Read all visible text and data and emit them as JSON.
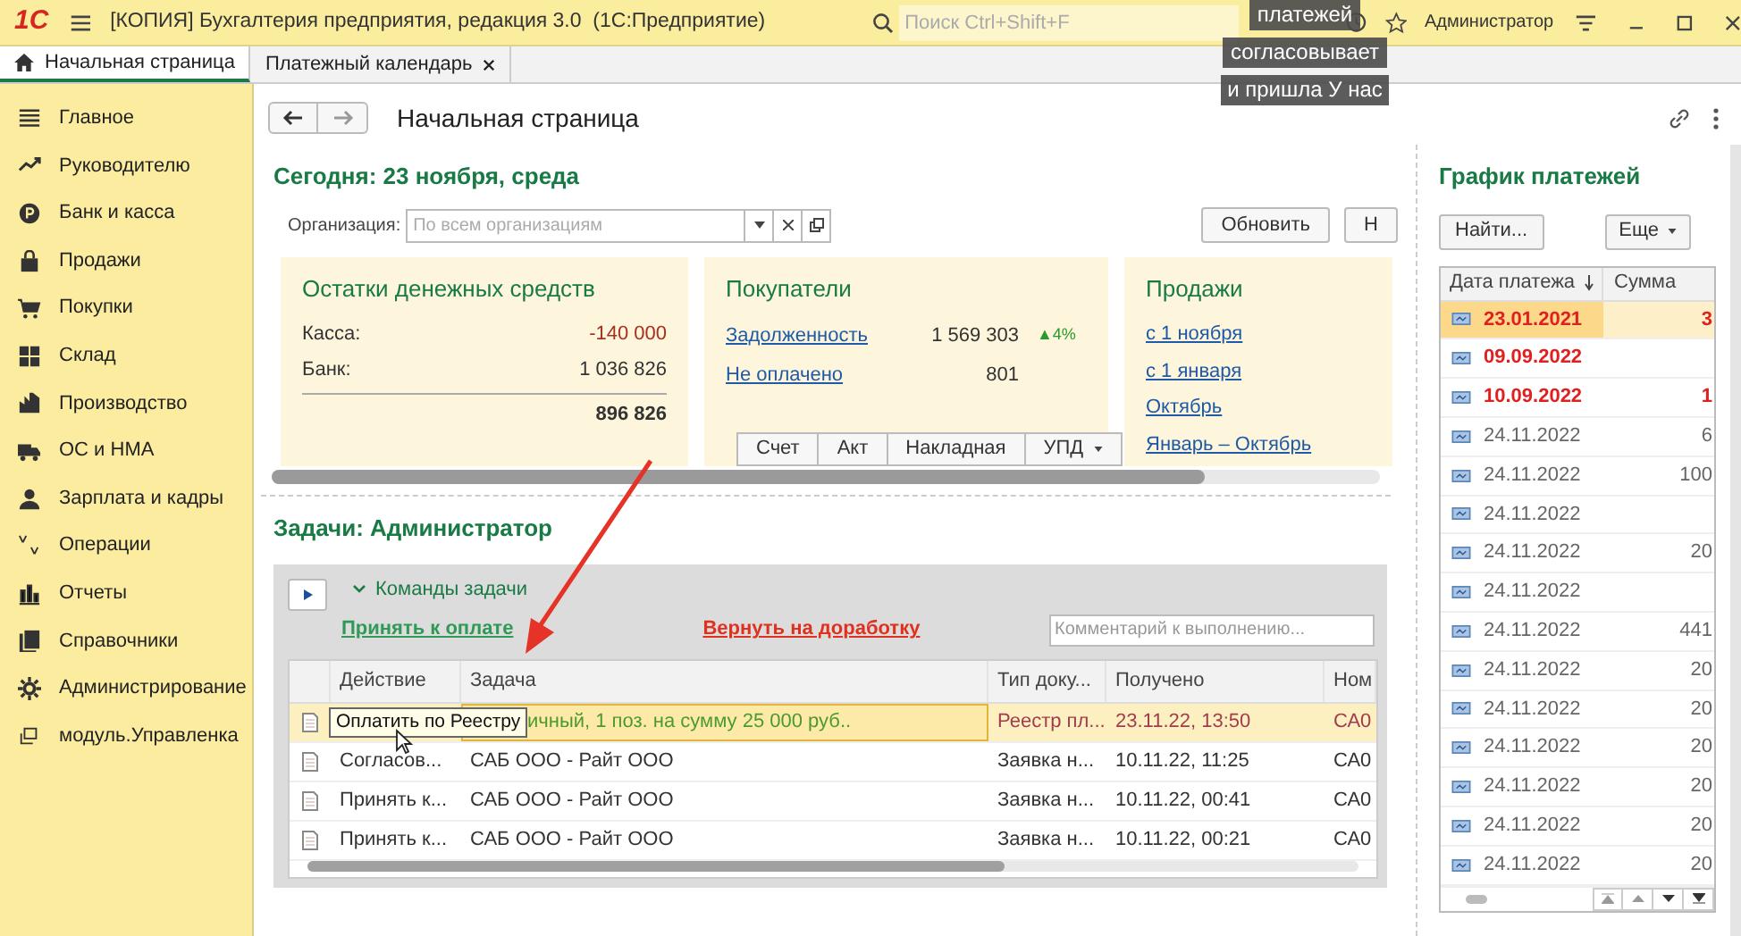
{
  "app_bar": {
    "logo": "1С",
    "title": "[КОПИЯ] Бухгалтерия предприятия, редакция 3.0  (1С:Предприятие)",
    "search": {
      "placeholder": "Поиск Ctrl+Shift+F"
    },
    "user": "Администратор"
  },
  "tabs": [
    {
      "label": "Начальная страница",
      "selected": true,
      "closable": false
    },
    {
      "label": "Платежный календарь",
      "selected": false,
      "closable": true
    }
  ],
  "sidebar": {
    "items": [
      {
        "label": "Главное"
      },
      {
        "label": "Руководителю"
      },
      {
        "label": "Банк и касса"
      },
      {
        "label": "Продажи"
      },
      {
        "label": "Покупки"
      },
      {
        "label": "Склад"
      },
      {
        "label": "Производство"
      },
      {
        "label": "ОС и НМА"
      },
      {
        "label": "Зарплата и кадры"
      },
      {
        "label": "Операции"
      },
      {
        "label": "Отчеты"
      },
      {
        "label": "Справочники"
      },
      {
        "label": "Администрирование"
      },
      {
        "label": "модуль.Управленка"
      }
    ]
  },
  "page": {
    "title": "Начальная страница"
  },
  "today": {
    "heading": "Сегодня: 23 ноября, среда",
    "org_label": "Организация:",
    "org_placeholder": "По всем организациям",
    "buttons": [
      "Обновить",
      "Н"
    ]
  },
  "cards": [
    {
      "kind": "balances",
      "title": "Остатки денежных средств",
      "rows": [
        {
          "label": "Касса:",
          "value": "-140 000",
          "negative": true
        },
        {
          "label": "Банк:",
          "value": "1 036 826",
          "negative": false
        }
      ],
      "total": "896 826"
    },
    {
      "kind": "customers",
      "title": "Покупатели",
      "rows": [
        {
          "label": "Задолженность",
          "value": "1 569 303",
          "trend": "▲4%"
        },
        {
          "label": "Не оплачено",
          "value": "801"
        }
      ],
      "buttons": [
        {
          "label": "Счет",
          "dropdown": false
        },
        {
          "label": "Акт",
          "dropdown": false
        },
        {
          "label": "Накладная",
          "dropdown": false
        },
        {
          "label": "УПД",
          "dropdown": true
        }
      ]
    },
    {
      "kind": "sales",
      "title": "Продажи",
      "links": [
        "с 1 ноября",
        "с 1 января",
        "Октябрь",
        "Январь – Октябрь"
      ]
    }
  ],
  "tasks": {
    "heading": "Задачи: Администратор",
    "commands_label": "Команды задачи",
    "accept": "Принять к оплате",
    "return": "Вернуть на доработку",
    "comment_placeholder": "Комментарий к выполнению...",
    "columns": [
      "Действие",
      "Задача",
      "Тип доку...",
      "Получено",
      "Ном"
    ],
    "rows": [
      {
        "action": "",
        "task": "ичный, 1 поз. на сумму 25 000 руб..",
        "type": "Реестр пл...",
        "received": "23.11.22, 13:50",
        "number": "СА0",
        "selected": true
      },
      {
        "action": "Согласов...",
        "task": "САБ ООО - Райт ООО",
        "type": "Заявка н...",
        "received": "10.11.22, 11:25",
        "number": "СА0",
        "selected": false
      },
      {
        "action": "Принять к...",
        "task": "САБ ООО - Райт ООО",
        "type": "Заявка н...",
        "received": "10.11.22, 00:41",
        "number": "СА0",
        "selected": false
      },
      {
        "action": "Принять к...",
        "task": "САБ ООО - Райт ООО",
        "type": "Заявка н...",
        "received": "10.11.22, 00:21",
        "number": "СА0",
        "selected": false
      }
    ],
    "tooltip": "Оплатить по Реестру"
  },
  "payments": {
    "heading": "График платежей",
    "find": "Найти...",
    "more": "Еще",
    "columns": [
      "Дата платежа",
      "Сумма"
    ],
    "rows": [
      {
        "date": "23.01.2021",
        "sum": "3",
        "overdue": true,
        "selected": true
      },
      {
        "date": "09.09.2022",
        "sum": "",
        "overdue": true,
        "selected": false
      },
      {
        "date": "10.09.2022",
        "sum": "1",
        "overdue": true,
        "selected": false
      },
      {
        "date": "24.11.2022",
        "sum": "6",
        "overdue": false,
        "selected": false
      },
      {
        "date": "24.11.2022",
        "sum": "100",
        "overdue": false,
        "selected": false
      },
      {
        "date": "24.11.2022",
        "sum": "",
        "overdue": false,
        "selected": false
      },
      {
        "date": "24.11.2022",
        "sum": "20",
        "overdue": false,
        "selected": false
      },
      {
        "date": "24.11.2022",
        "sum": "",
        "overdue": false,
        "selected": false
      },
      {
        "date": "24.11.2022",
        "sum": "441",
        "overdue": false,
        "selected": false
      },
      {
        "date": "24.11.2022",
        "sum": "20",
        "overdue": false,
        "selected": false
      },
      {
        "date": "24.11.2022",
        "sum": "20",
        "overdue": false,
        "selected": false
      },
      {
        "date": "24.11.2022",
        "sum": "20",
        "overdue": false,
        "selected": false
      },
      {
        "date": "24.11.2022",
        "sum": "20",
        "overdue": false,
        "selected": false
      },
      {
        "date": "24.11.2022",
        "sum": "20",
        "overdue": false,
        "selected": false
      },
      {
        "date": "24.11.2022",
        "sum": "20",
        "overdue": false,
        "selected": false
      }
    ]
  },
  "captions": [
    "платежей",
    "согласовывает",
    "и пришла У нас"
  ]
}
